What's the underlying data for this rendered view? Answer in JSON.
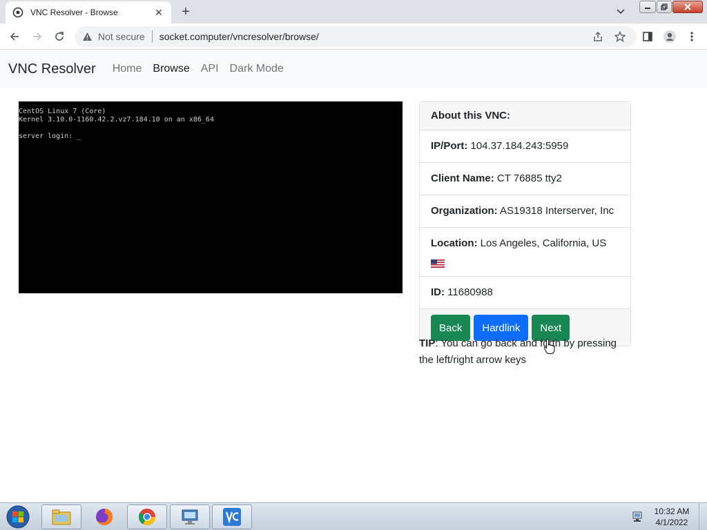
{
  "browser": {
    "tab_title": "VNC Resolver - Browse",
    "close_tab": "✕",
    "new_tab": "+",
    "not_secure": "Not secure",
    "url": "socket.computer/vncresolver/browse/"
  },
  "navbar": {
    "brand": "VNC Resolver",
    "links": [
      "Home",
      "Browse",
      "API",
      "Dark Mode"
    ],
    "active_index": 1
  },
  "vnc_screen": {
    "lines": [
      "CentOS Linux 7 (Core)",
      "Kernel 3.10.0-1160.42.2.vz7.184.10 on an x86_64",
      "",
      "server login: _"
    ]
  },
  "info_card": {
    "header": "About this VNC:",
    "ip_label": "IP/Port:",
    "ip_value": "104.37.184.243:5959",
    "client_label": "Client Name:",
    "client_value": "CT 76885 tty2",
    "org_label": "Organization:",
    "org_value": "AS19318 Interserver, Inc",
    "location_label": "Location:",
    "location_value": "Los Angeles, California, US",
    "id_label": "ID:",
    "id_value": "11680988",
    "buttons": {
      "back": "Back",
      "hardlink": "Hardlink",
      "next": "Next"
    }
  },
  "tip": {
    "label": "TIP",
    "text": ": You can go back and forth by pressing the left/right arrow keys"
  },
  "taskbar": {
    "time": "10:32 AM",
    "date": "4/1/2022"
  },
  "colors": {
    "green": "#198754",
    "blue": "#0d6efd"
  }
}
